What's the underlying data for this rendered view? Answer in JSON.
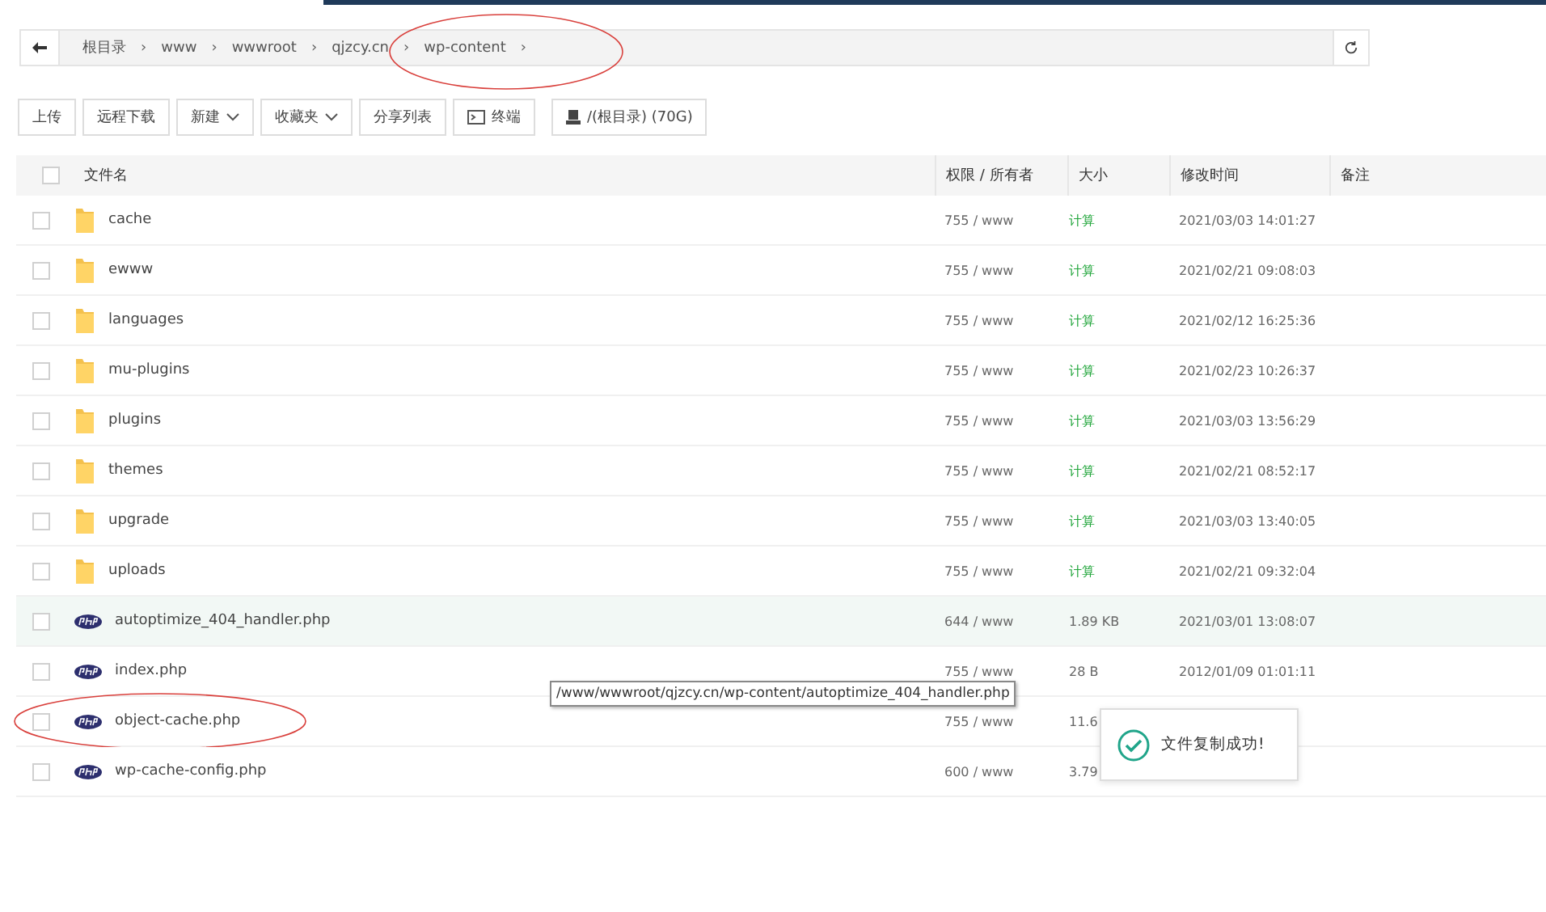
{
  "path_bar": {
    "separator": "›",
    "crumbs": [
      {
        "label": "根目录",
        "circled": false
      },
      {
        "label": "www",
        "circled": false
      },
      {
        "label": "wwwroot",
        "circled": false
      },
      {
        "label": "qjzcy.cn",
        "circled": false
      },
      {
        "label": "wp-content",
        "circled": true
      }
    ]
  },
  "toolbar": [
    {
      "label": "上传",
      "kind": "plain"
    },
    {
      "label": "远程下载",
      "kind": "plain"
    },
    {
      "label": "新建",
      "kind": "dropdown"
    },
    {
      "label": "收藏夹",
      "kind": "dropdown"
    },
    {
      "label": "分享列表",
      "kind": "plain"
    },
    {
      "label": "终端",
      "kind": "terminal"
    },
    {
      "label": "/(根目录) (70G)",
      "kind": "disk"
    }
  ],
  "table": {
    "select_all_checked": false,
    "columns": [
      "文件名",
      "权限 / 所有者",
      "大小",
      "修改时间",
      "备注"
    ],
    "rows": [
      {
        "kind": "folder",
        "name": "cache",
        "perm": "755 / www",
        "size": "计算",
        "time": "2021/03/03 14:01:27",
        "hovered": false,
        "circled": false
      },
      {
        "kind": "folder",
        "name": "ewww",
        "perm": "755 / www",
        "size": "计算",
        "time": "2021/02/21 09:08:03",
        "hovered": false,
        "circled": false
      },
      {
        "kind": "folder",
        "name": "languages",
        "perm": "755 / www",
        "size": "计算",
        "time": "2021/02/12 16:25:36",
        "hovered": false,
        "circled": false
      },
      {
        "kind": "folder",
        "name": "mu-plugins",
        "perm": "755 / www",
        "size": "计算",
        "time": "2021/02/23 10:26:37",
        "hovered": false,
        "circled": false
      },
      {
        "kind": "folder",
        "name": "plugins",
        "perm": "755 / www",
        "size": "计算",
        "time": "2021/03/03 13:56:29",
        "hovered": false,
        "circled": false
      },
      {
        "kind": "folder",
        "name": "themes",
        "perm": "755 / www",
        "size": "计算",
        "time": "2021/02/21 08:52:17",
        "hovered": false,
        "circled": false
      },
      {
        "kind": "folder",
        "name": "upgrade",
        "perm": "755 / www",
        "size": "计算",
        "time": "2021/03/03 13:40:05",
        "hovered": false,
        "circled": false
      },
      {
        "kind": "folder",
        "name": "uploads",
        "perm": "755 / www",
        "size": "计算",
        "time": "2021/02/21 09:32:04",
        "hovered": false,
        "circled": false
      },
      {
        "kind": "php",
        "name": "autoptimize_404_handler.php",
        "perm": "644 / www",
        "size": "1.89 KB",
        "time": "2021/03/01 13:08:07",
        "hovered": true,
        "circled": false
      },
      {
        "kind": "php",
        "name": "index.php",
        "perm": "755 / www",
        "size": "28 B",
        "time": "2012/01/09 01:01:11",
        "hovered": false,
        "circled": false
      },
      {
        "kind": "php",
        "name": "object-cache.php",
        "perm": "755 / www",
        "size": "11.6",
        "hovered": false,
        "circled": true
      },
      {
        "kind": "php",
        "name": "wp-cache-config.php",
        "perm": "600 / www",
        "size": "3.79",
        "hovered": false,
        "circled": false
      }
    ]
  },
  "tooltip": "/www/wwwroot/qjzcy.cn/wp-content/autoptimize_404_handler.php",
  "toast": "文件复制成功!"
}
